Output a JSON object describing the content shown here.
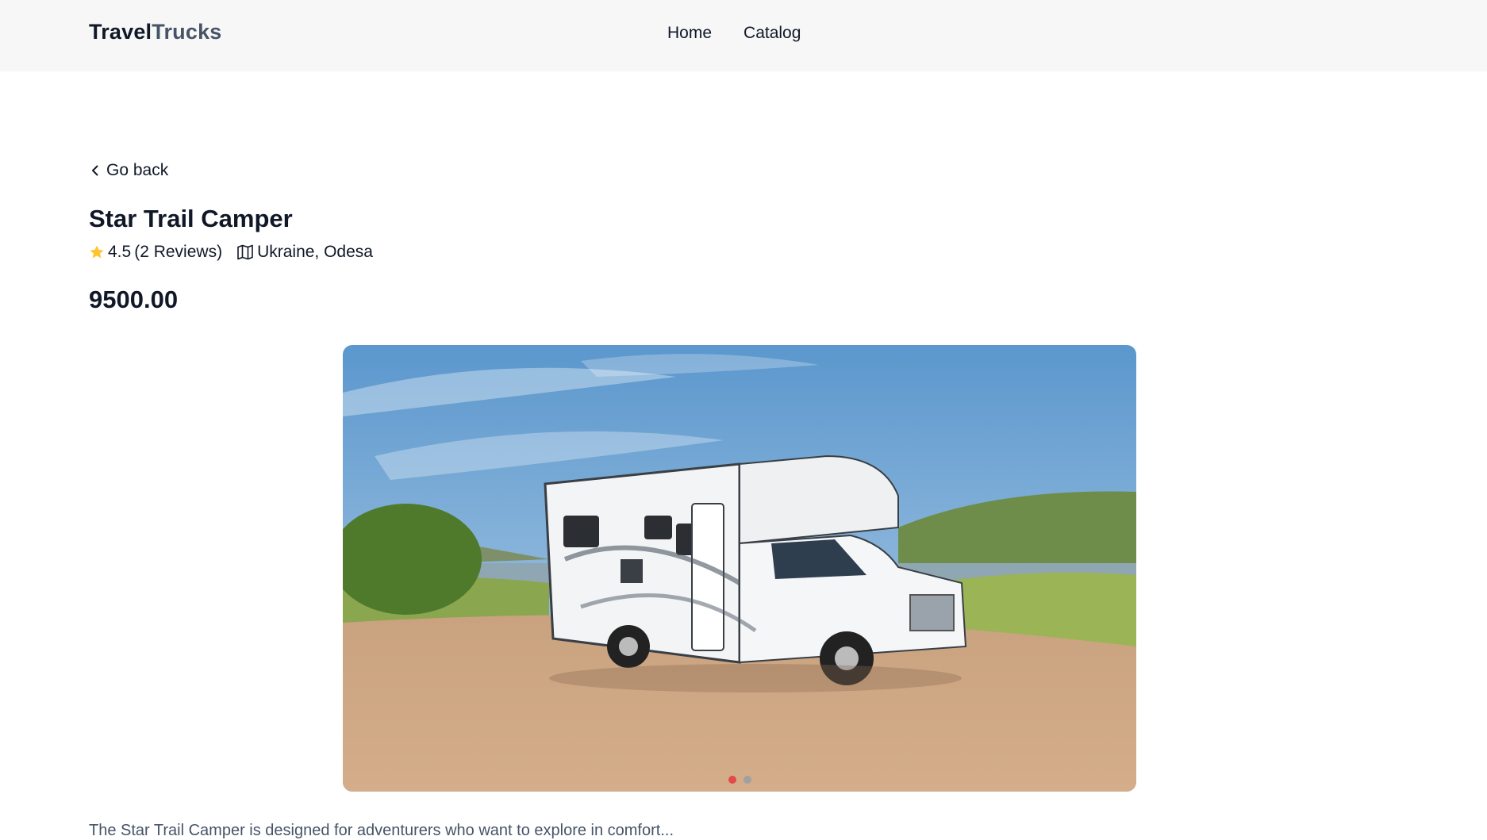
{
  "header": {
    "logo_part1": "Travel",
    "logo_part2": "Trucks",
    "nav": [
      {
        "label": "Home"
      },
      {
        "label": "Catalog"
      }
    ]
  },
  "camper": {
    "back_label": "Go back",
    "name": "Star Trail Camper",
    "rating": "4.5",
    "reviews": "(2 Reviews)",
    "location": "Ukraine, Odesa",
    "price": "9500.00",
    "description": "The Star Trail Camper is designed for adventurers who want to explore in comfort...",
    "gallery": {
      "slides": 2,
      "active_index": 0
    }
  },
  "colors": {
    "accent": "#e44848",
    "star": "#ffc531",
    "text_main": "#101828",
    "text_secondary": "#475467",
    "header_bg": "#f7f7f7"
  },
  "icons": {
    "back": "chevron-left-icon",
    "rating": "star-icon",
    "location": "map-icon"
  }
}
